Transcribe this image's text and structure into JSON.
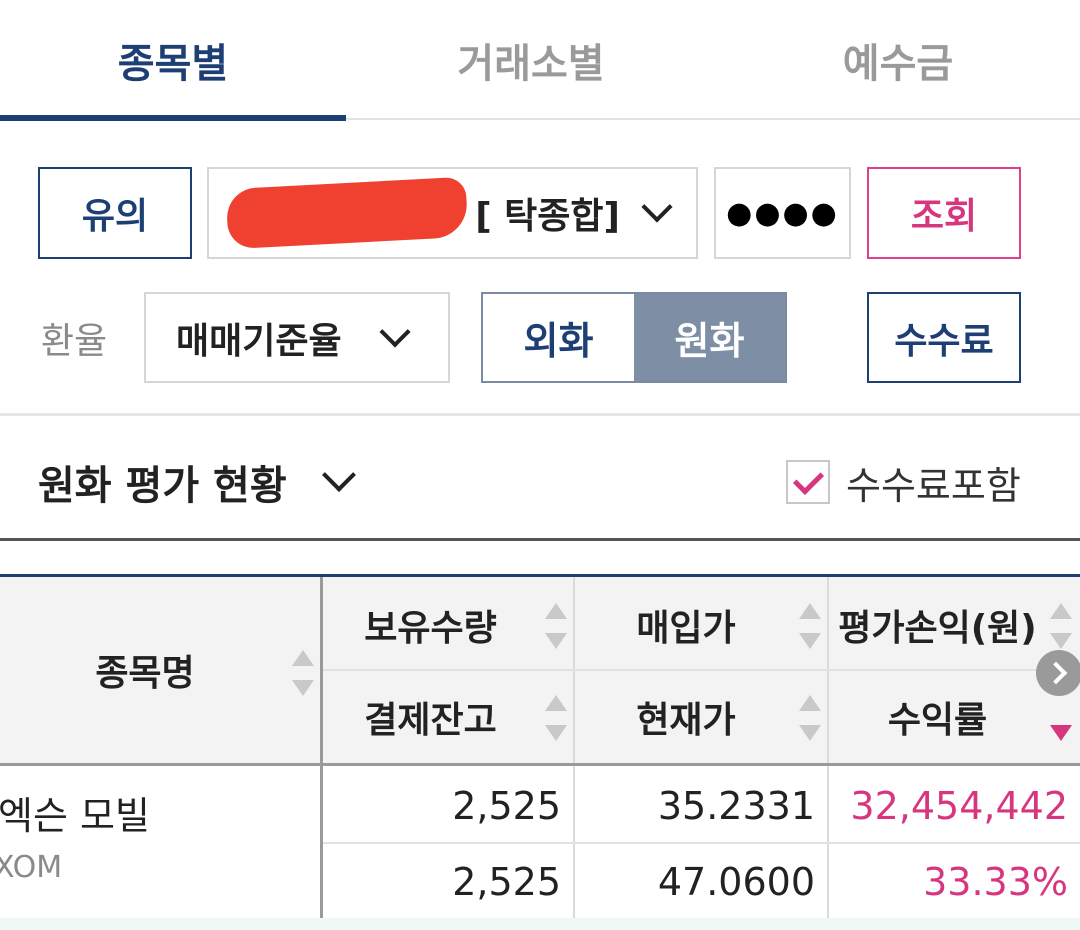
{
  "tabs": [
    {
      "label": "종목별",
      "active": true
    },
    {
      "label": "거래소별",
      "active": false
    },
    {
      "label": "예수금",
      "active": false
    }
  ],
  "controls": {
    "notice_label": "유의",
    "account_select_value": "[ 탁종합]",
    "password_masked": "●●●●",
    "search_label": "조회",
    "exchange_rate_label": "환율",
    "exchange_rate_value": "매매기준율",
    "currency_toggle": {
      "foreign": "외화",
      "won": "원화",
      "selected": "원화"
    },
    "fee_label": "수수료"
  },
  "section": {
    "title": "원화 평가 현황",
    "include_fee_label": "수수료포함",
    "include_fee_checked": true
  },
  "table": {
    "headers": {
      "name": "종목명",
      "top": [
        "보유수량",
        "매입가",
        "평가손익(원)"
      ],
      "bottom": [
        "결제잔고",
        "현재가",
        "수익률"
      ]
    },
    "rows": [
      {
        "name": "엑슨 모빌",
        "code": "XOM",
        "quantity": "2,525",
        "buy_price": "35.2331",
        "pnl": "32,454,442",
        "settled": "2,525",
        "current_price": "47.0600",
        "return_rate": "33.33%"
      }
    ]
  },
  "colors": {
    "navy": "#1d3f73",
    "pink": "#d8357f",
    "toggle_active_bg": "#7e8ea5",
    "redaction": "#f0402f"
  },
  "icons": [
    "chevron-down-icon",
    "checkmark-icon",
    "sort-icon",
    "scroll-right-icon"
  ]
}
